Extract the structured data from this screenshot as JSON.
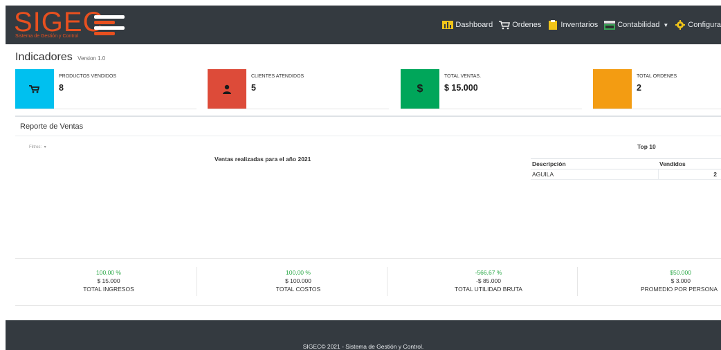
{
  "brand": {
    "name": "SIGEC",
    "subtitle": "Sistema de Gestión y Control",
    "color": "#e8501f"
  },
  "nav": [
    {
      "label": "Dashboard",
      "icon": "bar-chart-icon"
    },
    {
      "label": "Ordenes",
      "icon": "cart-icon"
    },
    {
      "label": "Inventarios",
      "icon": "clipboard-icon"
    },
    {
      "label": "Contabilidad",
      "icon": "cash-register-icon",
      "dropdown": true
    },
    {
      "label": "Configura",
      "icon": "gear-icon"
    }
  ],
  "page": {
    "title": "Indicadores",
    "version": "Version 1.0"
  },
  "info_boxes": [
    {
      "label": "PRODUCTOS VENDIDOS",
      "value": "8",
      "icon": "cart-icon",
      "color": "#00c0ef"
    },
    {
      "label": "CLIENTES ATENDIDOS",
      "value": "5",
      "icon": "user-icon",
      "color": "#dd4b39"
    },
    {
      "label": "TOTAL VENTAS.",
      "value": "$ 15.000",
      "icon": "dollar-icon",
      "color": "#00a65a"
    },
    {
      "label": "TOTAL ORDENES",
      "value": "2",
      "icon": "orders-icon",
      "color": "#f39c12"
    }
  ],
  "report": {
    "title": "Reporte de Ventas",
    "filters_label": "Filtros:",
    "chart_title": "Ventas realizadas para el año 2021",
    "top10": {
      "title": "Top 10",
      "headers": [
        "Descripción",
        "Vendidos"
      ],
      "rows": [
        {
          "descripcion": "AGUILA",
          "vendidos": "2"
        }
      ]
    }
  },
  "kpis": [
    {
      "pct": "100,00 %",
      "amount": "$ 15.000",
      "label": "TOTAL INGRESOS"
    },
    {
      "pct": "100,00 %",
      "amount": "$ 100.000",
      "label": "TOTAL COSTOS"
    },
    {
      "pct": "-566,67 %",
      "amount": "-$ 85.000",
      "label": "TOTAL UTILIDAD BRUTA"
    },
    {
      "pct": "$50.000",
      "amount": "$ 3.000",
      "label": "PROMEDIO POR PERSONA"
    }
  ],
  "footer": {
    "text": "SIGEC© 2021 - Sistema de Gestión y Control."
  },
  "colors": {
    "navbar": "#343a40",
    "positive": "#28a745"
  }
}
